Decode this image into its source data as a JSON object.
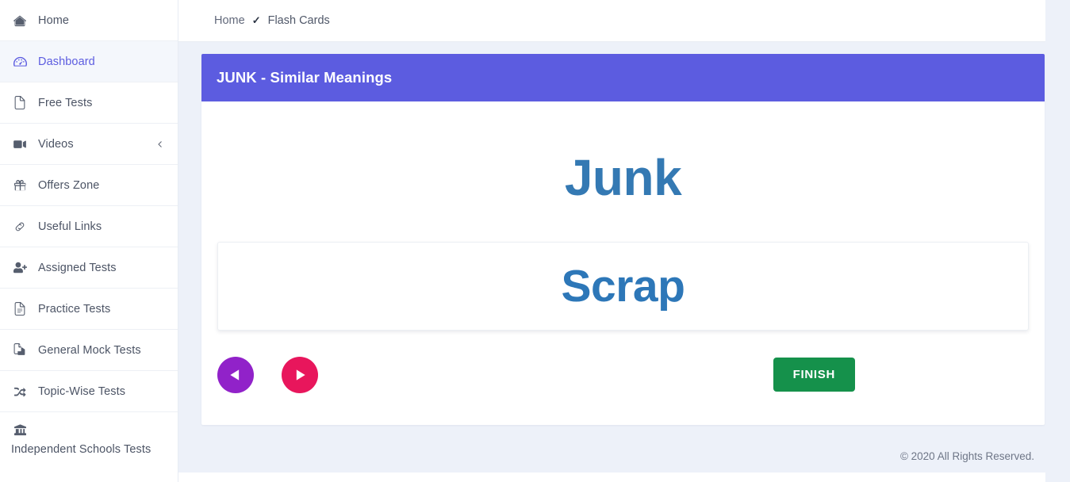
{
  "sidebar": {
    "items": [
      {
        "label": "Home",
        "icon": "home-icon",
        "active": false,
        "chevron": false
      },
      {
        "label": "Dashboard",
        "icon": "dashboard-icon",
        "active": true,
        "chevron": false
      },
      {
        "label": "Free Tests",
        "icon": "file-icon",
        "active": false,
        "chevron": false
      },
      {
        "label": "Videos",
        "icon": "video-camera-icon",
        "active": false,
        "chevron": true
      },
      {
        "label": "Offers Zone",
        "icon": "gift-icon",
        "active": false,
        "chevron": false
      },
      {
        "label": "Useful Links",
        "icon": "link-icon",
        "active": false,
        "chevron": false
      },
      {
        "label": "Assigned Tests",
        "icon": "user-plus-icon",
        "active": false,
        "chevron": false
      },
      {
        "label": "Practice Tests",
        "icon": "file-lines-icon",
        "active": false,
        "chevron": false
      },
      {
        "label": "General Mock Tests",
        "icon": "copy-files-icon",
        "active": false,
        "chevron": false
      },
      {
        "label": "Topic-Wise Tests",
        "icon": "shuffle-icon",
        "active": false,
        "chevron": false
      },
      {
        "label": "Independent Schools Tests",
        "icon": "bank-icon",
        "active": false,
        "chevron": false
      }
    ]
  },
  "breadcrumb": {
    "home": "Home",
    "separator": "✓",
    "current": "Flash Cards"
  },
  "card": {
    "header_title": "JUNK - Similar Meanings",
    "front_word": "Junk",
    "back_word": "Scrap"
  },
  "controls": {
    "prev_label": "previous-card",
    "next_label": "next-card",
    "finish_label": "FINISH"
  },
  "footer": {
    "copyright": "© 2020 All Rights Reserved."
  },
  "colors": {
    "accent_header": "#5c5ce0",
    "word_blue": "#3479b3",
    "prev_purple": "#9122c9",
    "next_pink": "#e8165c",
    "finish_green": "#15914b",
    "page_bg": "#edf1f9"
  }
}
